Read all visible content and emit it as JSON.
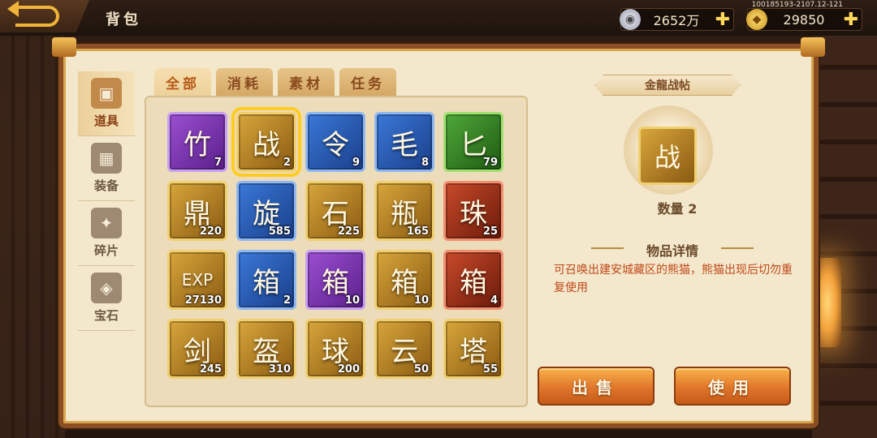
{
  "topbar": {
    "title": "背包",
    "server_info": "100185193-2107.12-121",
    "silver": {
      "value": "2652万",
      "icon": "silver-coin-icon"
    },
    "gold": {
      "value": "29850",
      "icon": "gold-ingot-icon"
    }
  },
  "side_tabs": [
    {
      "label": "道具",
      "icon": "chest-icon",
      "active": true
    },
    {
      "label": "装备",
      "icon": "armor-icon",
      "active": false
    },
    {
      "label": "碎片",
      "icon": "puzzle-icon",
      "active": false
    },
    {
      "label": "宝石",
      "icon": "gem-icon",
      "active": false
    }
  ],
  "top_tabs": [
    {
      "label": "全部",
      "active": true
    },
    {
      "label": "消耗",
      "active": false
    },
    {
      "label": "素材",
      "active": false
    },
    {
      "label": "任务",
      "active": false
    }
  ],
  "items": [
    {
      "icon": "bamboo-icon",
      "glyph": "竹",
      "count": "7",
      "rarity": "purple",
      "selected": false
    },
    {
      "icon": "scroll-icon",
      "glyph": "战",
      "count": "2",
      "rarity": "gold",
      "selected": true
    },
    {
      "icon": "token-icon",
      "glyph": "令",
      "count": "9",
      "rarity": "blue",
      "selected": false
    },
    {
      "icon": "fur-icon",
      "glyph": "毛",
      "count": "8",
      "rarity": "blue",
      "selected": false
    },
    {
      "icon": "dagger-icon",
      "glyph": "匕",
      "count": "79",
      "rarity": "green",
      "selected": false
    },
    {
      "icon": "cauldron-icon",
      "glyph": "鼎",
      "count": "220",
      "rarity": "gold",
      "selected": false
    },
    {
      "icon": "vortex-icon",
      "glyph": "旋",
      "count": "585",
      "rarity": "blue",
      "selected": false
    },
    {
      "icon": "ore-icon",
      "glyph": "石",
      "count": "225",
      "rarity": "gold",
      "selected": false
    },
    {
      "icon": "potion-icon",
      "glyph": "瓶",
      "count": "165",
      "rarity": "gold",
      "selected": false
    },
    {
      "icon": "crystal-ball-icon",
      "glyph": "珠",
      "count": "25",
      "rarity": "red",
      "selected": false
    },
    {
      "icon": "exp-icon",
      "glyph": "EXP",
      "count": "27130",
      "rarity": "gold",
      "selected": false
    },
    {
      "icon": "treasure-chest-icon",
      "glyph": "箱",
      "count": "2",
      "rarity": "blue",
      "selected": false
    },
    {
      "icon": "silver-chest-icon",
      "glyph": "箱",
      "count": "10",
      "rarity": "purple",
      "selected": false
    },
    {
      "icon": "gold-chest-icon",
      "glyph": "箱",
      "count": "10",
      "rarity": "gold",
      "selected": false
    },
    {
      "icon": "jade-chest-icon",
      "glyph": "箱",
      "count": "4",
      "rarity": "red",
      "selected": false
    },
    {
      "icon": "sword-orb-icon",
      "glyph": "剑",
      "count": "245",
      "rarity": "gold",
      "selected": false
    },
    {
      "icon": "helmet-orb-icon",
      "glyph": "盔",
      "count": "310",
      "rarity": "gold",
      "selected": false
    },
    {
      "icon": "ball-orb-icon",
      "glyph": "球",
      "count": "200",
      "rarity": "gold",
      "selected": false
    },
    {
      "icon": "cloud-orb-icon",
      "glyph": "云",
      "count": "50",
      "rarity": "gold",
      "selected": false
    },
    {
      "icon": "pagoda-orb-icon",
      "glyph": "塔",
      "count": "55",
      "rarity": "gold",
      "selected": false
    }
  ],
  "detail": {
    "name": "金龍战帖",
    "preview_glyph": "战",
    "quantity": "数量 2",
    "section_title": "物品详情",
    "description": "可召唤出建安城藏区的熊猫，熊猫出现后切勿重复使用"
  },
  "buttons": {
    "sell": "出售",
    "use": "使用"
  },
  "colors": {
    "accent": "#e0762a",
    "panel": "#f3e7cc",
    "gold_text": "#ffd75a"
  }
}
